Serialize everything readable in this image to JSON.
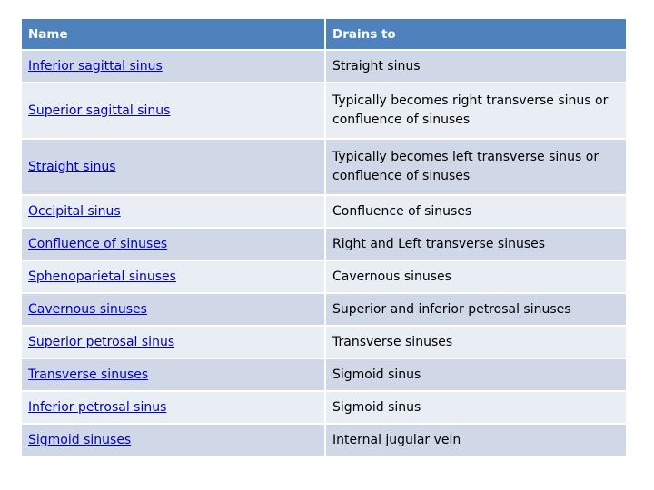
{
  "table": {
    "headers": {
      "name": "Name",
      "drains_to": "Drains to"
    },
    "rows": [
      {
        "name": "Inferior sagittal sinus",
        "drains_to": "Straight sinus"
      },
      {
        "name": "Superior sagittal sinus",
        "drains_to": "Typically becomes right transverse sinus or confluence of sinuses"
      },
      {
        "name": "Straight sinus",
        "drains_to": "Typically becomes left transverse sinus or confluence of sinuses"
      },
      {
        "name": "Occipital sinus",
        "drains_to": "Confluence of sinuses"
      },
      {
        "name": "Confluence of sinuses",
        "drains_to": "Right and Left transverse sinuses"
      },
      {
        "name": "Sphenoparietal sinuses",
        "drains_to": "Cavernous sinuses"
      },
      {
        "name": "Cavernous sinuses",
        "drains_to": "Superior and inferior petrosal sinuses"
      },
      {
        "name": "Superior petrosal sinus",
        "drains_to": "Transverse sinuses"
      },
      {
        "name": "Transverse sinuses",
        "drains_to": "Sigmoid sinus"
      },
      {
        "name": "Inferior petrosal sinus",
        "drains_to": "Sigmoid sinus"
      },
      {
        "name": "Sigmoid sinuses",
        "drains_to": "Internal jugular vein"
      }
    ]
  },
  "colors": {
    "header_bg": "#4f81bd",
    "row_dark": "#d0d8e8",
    "row_light": "#e9edf4",
    "link": "#0000cc"
  }
}
